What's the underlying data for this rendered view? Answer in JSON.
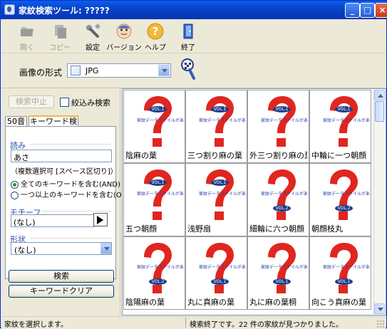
{
  "window": {
    "title": "家紋検索ツール: ?????",
    "controls": {
      "minimize": "_",
      "maximize": "□",
      "close": "×"
    }
  },
  "toolbar": {
    "items": [
      {
        "label": "開く",
        "icon": "open-folder-icon",
        "enabled": false
      },
      {
        "label": "コピー",
        "icon": "copy-icon",
        "enabled": false
      },
      {
        "label": "設定",
        "icon": "wrench-icon",
        "enabled": true
      },
      {
        "label": "バージョン",
        "icon": "info-avatar-icon",
        "enabled": true
      },
      {
        "label": "ヘルプ",
        "icon": "help-icon",
        "enabled": true
      },
      {
        "label": "終了",
        "icon": "exit-door-icon",
        "enabled": true
      }
    ]
  },
  "format": {
    "label": "画像の形式",
    "value": "JPG"
  },
  "search": {
    "stop_label": "検索中止",
    "narrow_label": "絞込み検索",
    "tabs": [
      "50音",
      "キーワード検索"
    ],
    "reading_label": "読み",
    "reading_value": "あさ",
    "reading_note": "（複数選択可 [スペース区切り]）",
    "radio_all": "全てのキーワードを含む(AND)",
    "radio_any": "一つ以上のキーワードを含む(OR)",
    "motif_label": "モチーフ",
    "motif_value": "(なし)",
    "shape_label": "形状",
    "shape_value": "(なし)",
    "search_button": "検索",
    "clear_button": "キーワードクリア"
  },
  "results": {
    "placeholder_badge": "VOL.1",
    "placeholder_badge_2": "VOL.2",
    "placeholder_text": "家紋データファイルがありません",
    "items": [
      "陰麻の葉",
      "三つ割り麻の葉",
      "外三つ割り麻の葉",
      "中輪に一つ朝顔",
      "五つ朝顔",
      "浅野扇",
      "細輪に六つ朝顔",
      "朝顔枝丸",
      "陰陽麻の葉",
      "丸に真麻の葉",
      "丸に麻の葉桐",
      "向こう真麻の葉"
    ]
  },
  "status": {
    "left": "家紋を選択します。",
    "right": "検索終了です。22 件の家紋が見つかりました。"
  },
  "colors": {
    "title_blue": "#0842c6",
    "question_red": "#e0261f",
    "active_tab_orange": "#f5b543"
  }
}
